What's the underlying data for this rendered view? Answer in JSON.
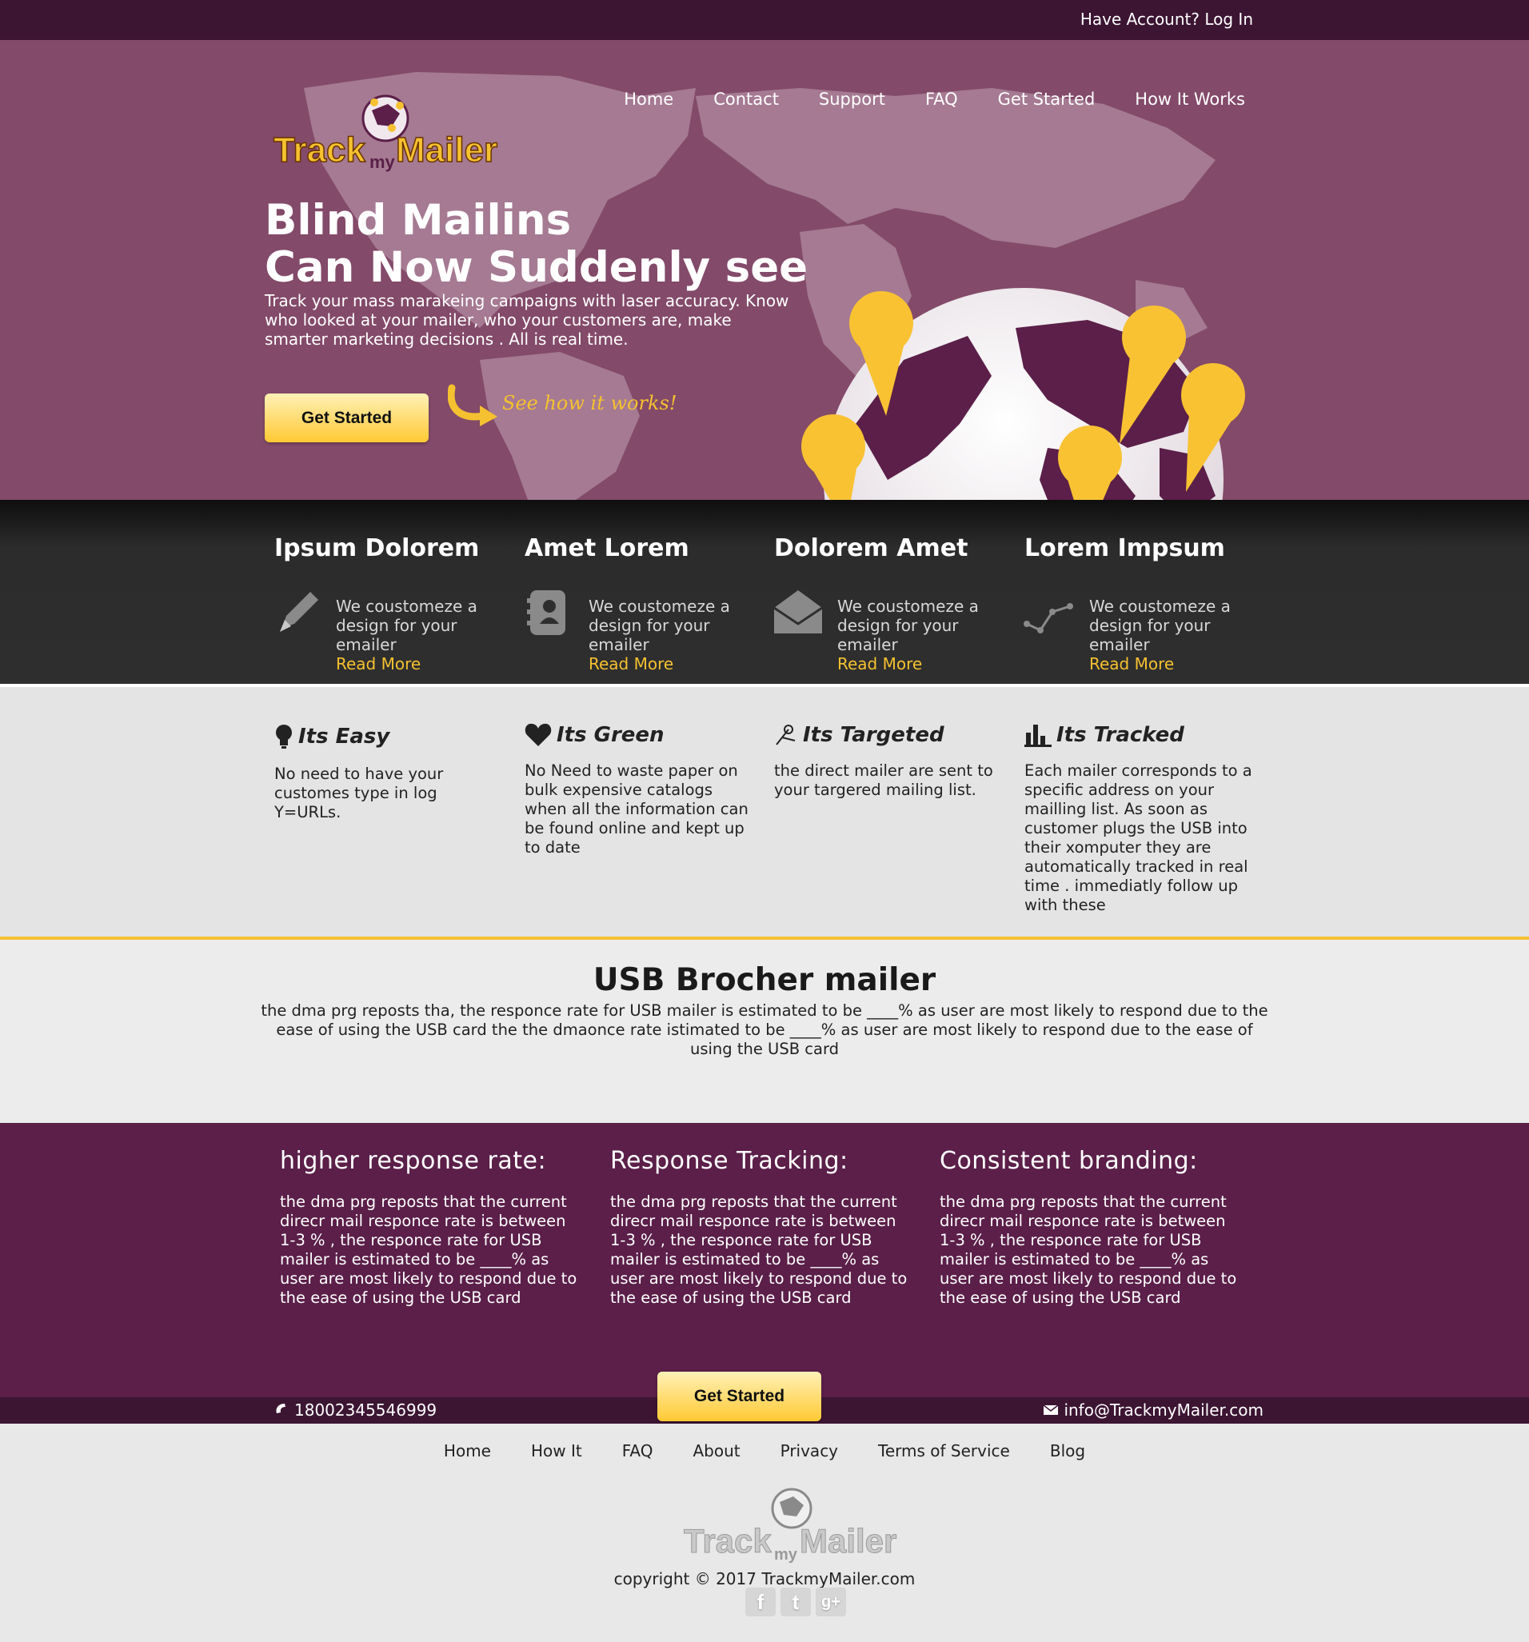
{
  "topbar": {
    "login": "Have Account? Log In"
  },
  "brand": {
    "name_part1": "Track",
    "name_part2": "my",
    "name_part3": "Mailer"
  },
  "nav": [
    {
      "label": "Home"
    },
    {
      "label": "Contact"
    },
    {
      "label": "Support"
    },
    {
      "label": "FAQ"
    },
    {
      "label": "Get Started"
    },
    {
      "label": "How It Works"
    }
  ],
  "hero": {
    "title_line1": "Blind Mailins",
    "title_line2": "Can Now Suddenly see",
    "lead": "Track your mass marakeing campaigns with laser accuracy. Know who looked at your mailer, who your customers are, make smarter marketing decisions . All is real time.",
    "cta": "Get Started",
    "see_how": "See how it works!"
  },
  "features": [
    {
      "title": "Ipsum Dolorem",
      "desc": "We coustomeze a design for your emailer",
      "more": "Read More",
      "icon": "pencil-icon"
    },
    {
      "title": "Amet Lorem",
      "desc": "We coustomeze a design for your emailer",
      "more": "Read More",
      "icon": "address-book-icon"
    },
    {
      "title": "Dolorem Amet",
      "desc": "We coustomeze a design for your emailer",
      "more": "Read More",
      "icon": "envelope-icon"
    },
    {
      "title": "Lorem Impsum",
      "desc": "We coustomeze a design for your emailer",
      "more": "Read More",
      "icon": "line-chart-icon"
    }
  ],
  "benefits": [
    {
      "title": "Its Easy",
      "text": "No need to have your customes type in log Y=URLs.",
      "icon": "lightbulb-icon"
    },
    {
      "title": "Its Green",
      "text": "No Need to waste paper on bulk expensive catalogs when all the information can be found online and kept up to date",
      "icon": "heart-icon"
    },
    {
      "title": "Its Targeted",
      "text": "the direct mailer are sent to your targered mailing list.",
      "icon": "target-icon"
    },
    {
      "title": "Its Tracked",
      "text": "Each mailer corresponds to a specific address on your mailling list. As soon as customer plugs the USB into their xomputer they are automatically tracked in real time . immediatly follow up with these",
      "icon": "bar-chart-icon"
    }
  ],
  "usb": {
    "title": "USB Brocher mailer",
    "text": "the dma prg reposts tha, the responce rate for USB mailer is estimated to be ____% as user are most likely to respond due to the ease of using the USB card the the dmaonce rate istimated to be ____% as user are most likely to respond due to the ease of using the USB card"
  },
  "columns": [
    {
      "title": "higher response rate:",
      "text": "the dma prg reposts that the current direcr mail responce rate is between 1-3 % , the responce rate for USB mailer is estimated to be ____% as user are most likely to respond due to the ease of using the USB card"
    },
    {
      "title": "Response Tracking:",
      "text": "the dma prg reposts that the current direcr mail responce rate is between 1-3 % , the responce rate for USB mailer is estimated to be ____% as user are most likely to respond due to the ease of using the USB card"
    },
    {
      "title": "Consistent branding:",
      "text": "the dma prg reposts that the current direcr mail responce rate is between 1-3 % , the responce rate for USB mailer is estimated to be ____% as user are most likely to respond due to the ease of using the USB card"
    }
  ],
  "contact": {
    "phone": "18002345546999",
    "email": "info@TrackmyMailer.com",
    "cta": "Get Started"
  },
  "footer": {
    "nav": [
      {
        "label": "Home"
      },
      {
        "label": "How It"
      },
      {
        "label": "FAQ"
      },
      {
        "label": "About"
      },
      {
        "label": "Privacy"
      },
      {
        "label": "Terms of Service"
      },
      {
        "label": "Blog"
      }
    ],
    "copyright": "copyright © 2017 TrackmyMailer.com",
    "social": [
      {
        "glyph": "f",
        "icon": "facebook-icon"
      },
      {
        "glyph": "t",
        "icon": "twitter-icon"
      },
      {
        "glyph": "g+",
        "icon": "google-plus-icon"
      }
    ]
  },
  "colors": {
    "accent": "#f5c130",
    "plum": "#5b1f49",
    "dark_plum": "#3c1533",
    "hero": "#834a69"
  }
}
